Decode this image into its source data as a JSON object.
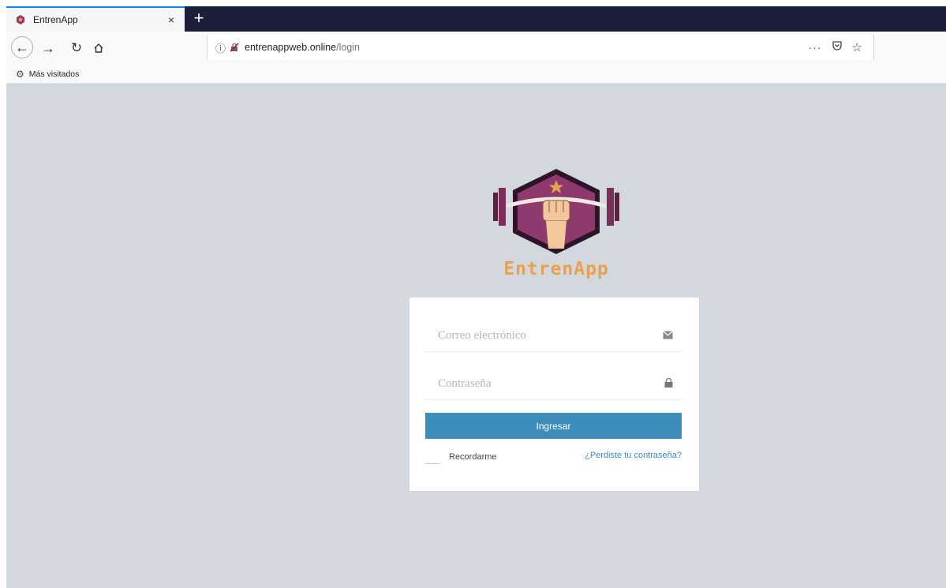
{
  "browser": {
    "tab_title": "EntrenApp",
    "tab_close": "×",
    "new_tab": "+",
    "url_host": "entrenappweb.online",
    "url_path": "/login",
    "page_actions": "···",
    "bookmark_label": "Más visitados"
  },
  "app": {
    "brand_name": "EntrenApp",
    "colors": {
      "page_bg": "#d3d8df",
      "brand_orange": "#e9a24c",
      "hexagon": "#8e3a6e",
      "button": "#3c8dbc"
    }
  },
  "login": {
    "email_placeholder": "Correo electrónico",
    "password_placeholder": "Contraseña",
    "email_icon": "envelope-icon",
    "password_icon": "lock-icon",
    "submit_label": "Ingresar",
    "remember_label": "Recordarme",
    "forgot_label": "¿Perdiste tu contraseña?"
  }
}
